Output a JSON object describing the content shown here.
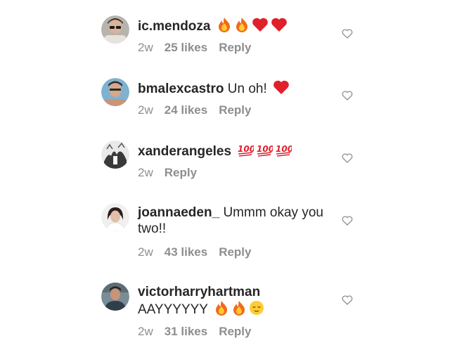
{
  "comments": [
    {
      "username": "ic.mendoza",
      "text": "",
      "emojis": [
        "fire-emoji",
        "fire-emoji",
        "red-heart-emoji",
        "red-heart-emoji"
      ],
      "time": "2w",
      "likes": "25 likes",
      "reply": "Reply"
    },
    {
      "username": "bmalexcastro",
      "text": "Un oh!",
      "emojis": [
        "red-heart-emoji"
      ],
      "time": "2w",
      "likes": "24 likes",
      "reply": "Reply"
    },
    {
      "username": "xanderangeles",
      "text": "",
      "emojis": [
        "hundred-points-emoji",
        "hundred-points-emoji",
        "hundred-points-emoji"
      ],
      "time": "2w",
      "likes": "",
      "reply": "Reply"
    },
    {
      "username": "joannaeden_",
      "text": "Ummm okay you two!!",
      "emojis": [],
      "time": "2w",
      "likes": "43 likes",
      "reply": "Reply"
    },
    {
      "username": "victorharryhartman",
      "text": "AAYYYYYY",
      "emojis": [
        "fire-emoji",
        "fire-emoji",
        "relieved-face-emoji"
      ],
      "time": "2w",
      "likes": "31 likes",
      "reply": "Reply"
    }
  ],
  "colors": {
    "text": "#262626",
    "meta": "#8e8e8e",
    "heart_outline": "#8e8e8e"
  },
  "icons": {
    "like": "heart-outline-icon"
  }
}
